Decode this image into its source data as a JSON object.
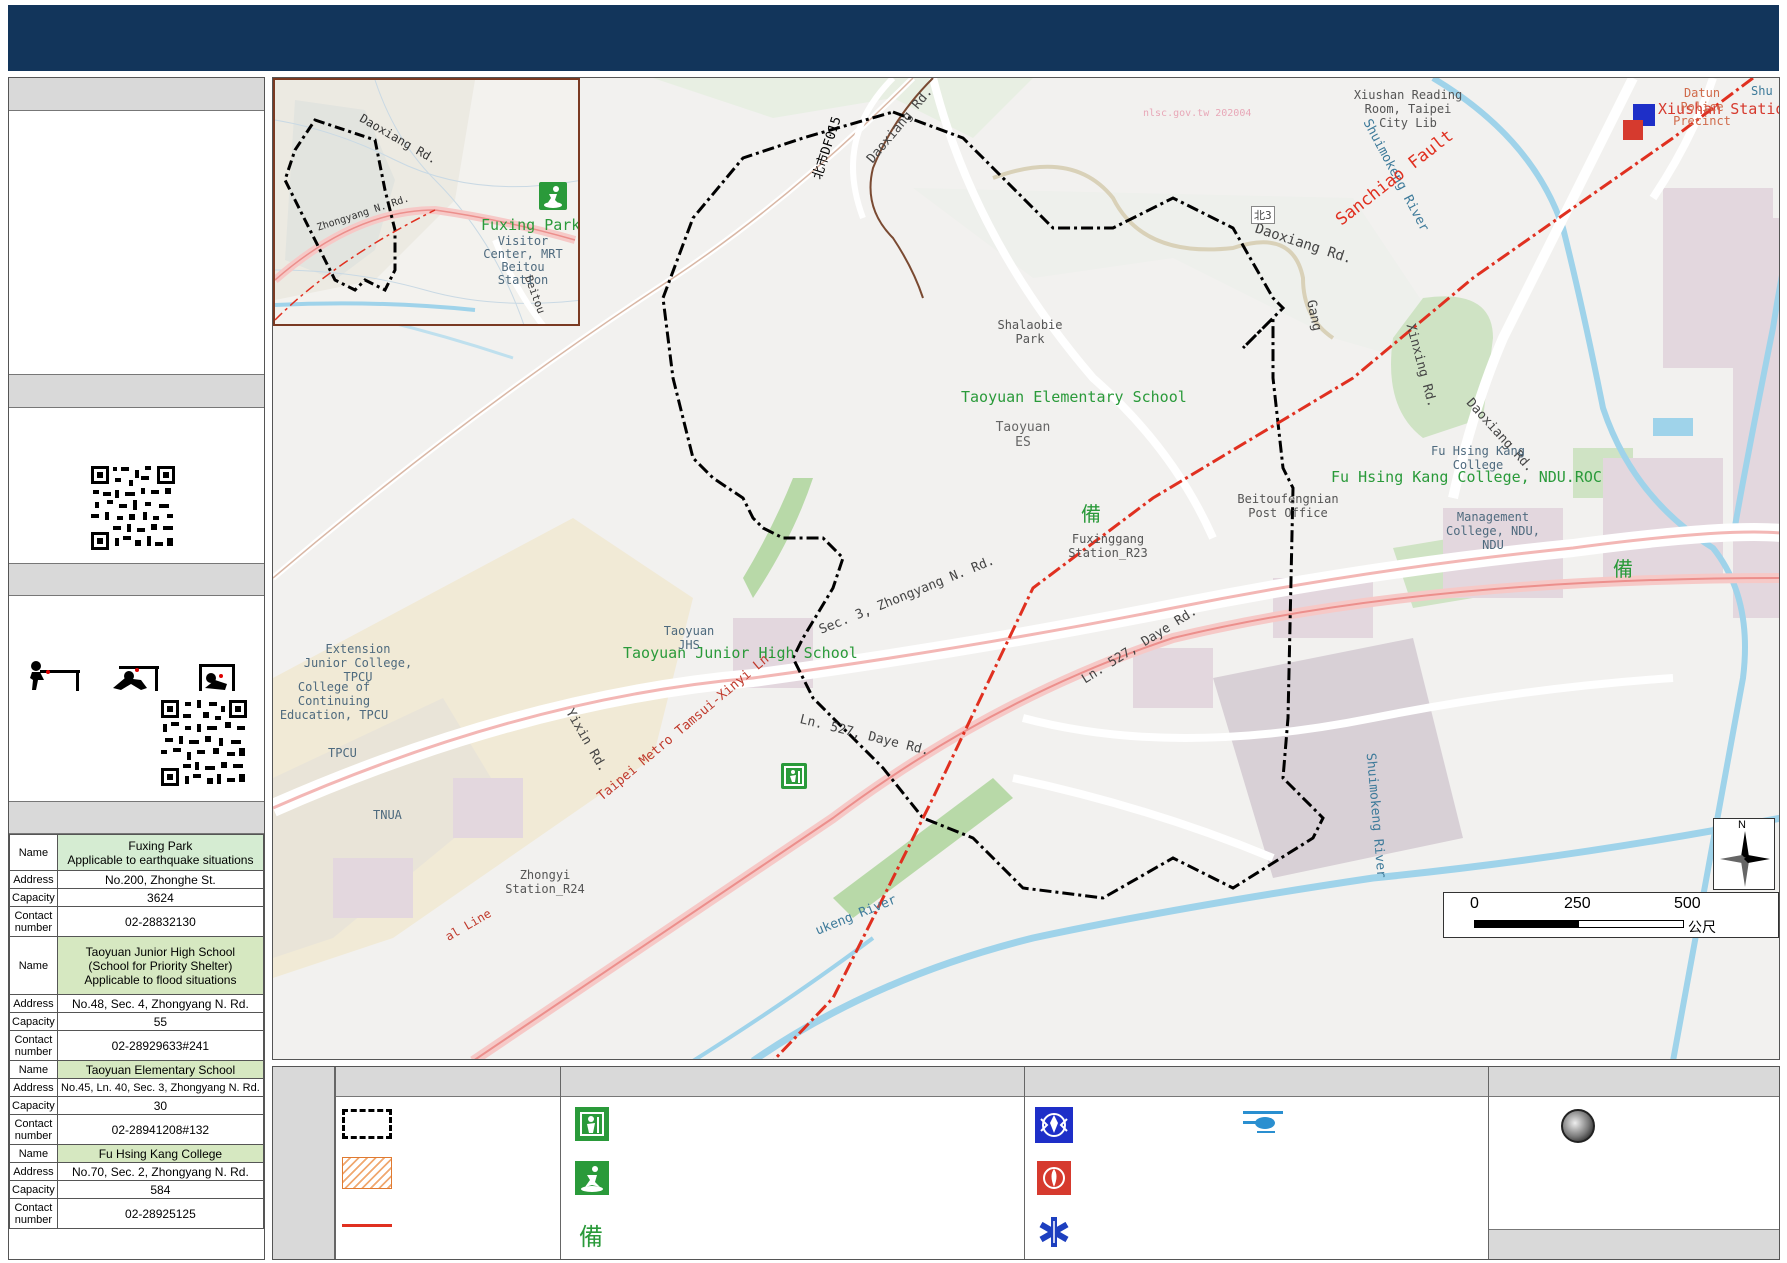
{
  "header": {
    "title": ""
  },
  "shelters": [
    {
      "name_label": "Name",
      "name": "Fuxing Park",
      "name_note": "Applicable to earthquake situations",
      "address_label": "Address",
      "address": "No.200, Zhonghe St.",
      "capacity_label": "Capacity",
      "capacity": "3624",
      "contact_label": "Contact number",
      "contact": "02-28832130"
    },
    {
      "name_label": "Name",
      "name": "Taoyuan Junior High School",
      "name_note": "(School for Priority Shelter)",
      "name_note2": "Applicable to flood situations",
      "address_label": "Address",
      "address": "No.48, Sec. 4, Zhongyang N. Rd.",
      "capacity_label": "Capacity",
      "capacity": "55",
      "contact_label": "Contact number",
      "contact": "02-28929633#241"
    },
    {
      "name_label": "Name",
      "name": "Taoyuan Elementary School",
      "address_label": "Address",
      "address": "No.45, Ln. 40, Sec. 3, Zhongyang N. Rd.",
      "capacity_label": "Capacity",
      "capacity": "30",
      "contact_label": "Contact number",
      "contact": "02-28941208#132"
    },
    {
      "name_label": "Name",
      "name": "Fu Hsing Kang College",
      "address_label": "Address",
      "address": "No.70, Sec. 2, Zhongyang N. Rd.",
      "capacity_label": "Capacity",
      "capacity": "584",
      "contact_label": "Contact number",
      "contact": "02-28925125"
    }
  ],
  "map": {
    "road_daoxiang_1": "Daoxiang Rd.",
    "road_daoxiang_2": "Daoxiang Rd.",
    "road_daoxiang_3": "Daoxiang Rd.",
    "road_zhongyang": "Sec. 3, Zhongyang N. Rd.",
    "road_daye": "Ln. 527, Daye Rd.",
    "road_daye_2": "Ln. 527, Daye Rd.",
    "road_yixin": "Yixin Rd.",
    "road_xinxing": "Xinxing Rd.",
    "road_gang": "Gang",
    "road_shuimokeng": "Shuimokeng River",
    "road_shuimokeng_2": "Shuimokeng River",
    "road_shuimokeng_3": "ukeng River",
    "road_metro": "Taipei Metro Tamsui-Xinyi Ln.",
    "road_beitou3": "北3",
    "road_df015": "北市DF015",
    "road_ln": "al Line",
    "fault_label": "Sanchiao Fault",
    "poi_shalaobie": "Shalaobie Park",
    "poi_taoyuan_es_shelter": "Taoyuan Elementary School",
    "poi_taoyuan_es": "Taoyuan ES",
    "poi_fuxinggang": "Fuxinggang Station_R23",
    "poi_post": "Beitoufengnian Post Office",
    "poi_fhk_label": "Fu Hsing Kang College",
    "poi_fhk_shelter": "Fu Hsing Kang College, NDU.ROC",
    "poi_mgmt": "Management College, NDU, NDU",
    "poi_taoyuan_jhs": "Taoyuan JHS",
    "poi_taoyuan_jhs_shelter": "Taoyuan Junior High School",
    "poi_extension": "Extension Junior College, TPCU",
    "poi_continuing": "College of Continuing Education, TPCU",
    "poi_tpcu": "TPCU",
    "poi_tnua": "TNUA",
    "poi_zhongyi": "Zhongyi Station_R24",
    "poi_xiushan_reading": "Xiushan Reading Room, Taipei City Lib",
    "poi_xiushan_station": "Xiushan Station",
    "poi_datun": "Datun Police Precinct",
    "poi_shu": "Shu",
    "watermark": "nlsc.gov.tw 202004"
  },
  "inset": {
    "road_daoxiang": "Daoxiang Rd.",
    "road_zhongyang": "Zhongyang N. Rd.",
    "road_beitou": "Beitou",
    "poi_fuxing_park": "Fuxing Park",
    "poi_visitor": "Visitor Center, MRT Beitou Station"
  },
  "scale": {
    "t0": "0",
    "t250": "250",
    "t500": "500",
    "unit": "公尺"
  },
  "compass": {
    "north": "N"
  },
  "legend_symbols": {
    "reserve": "備"
  },
  "colors": {
    "header": "#12355b",
    "shelter_green": "#2a9a3a",
    "fault_red": "#e03020",
    "boundary": "#000000"
  }
}
